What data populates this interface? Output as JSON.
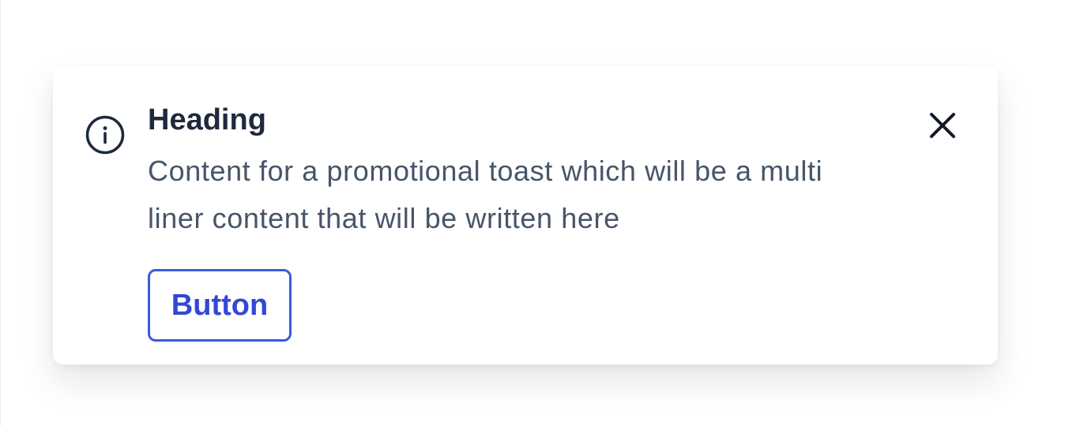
{
  "toast": {
    "icon": "info-icon",
    "heading": "Heading",
    "body": "Content for a promotional toast which will be a multi liner content that will be written here",
    "button_label": "Button",
    "close_icon": "close-icon"
  },
  "colors": {
    "heading": "#1e293b",
    "body": "#475569",
    "accent": "#3b5bdb",
    "icon": "#1e293b"
  }
}
